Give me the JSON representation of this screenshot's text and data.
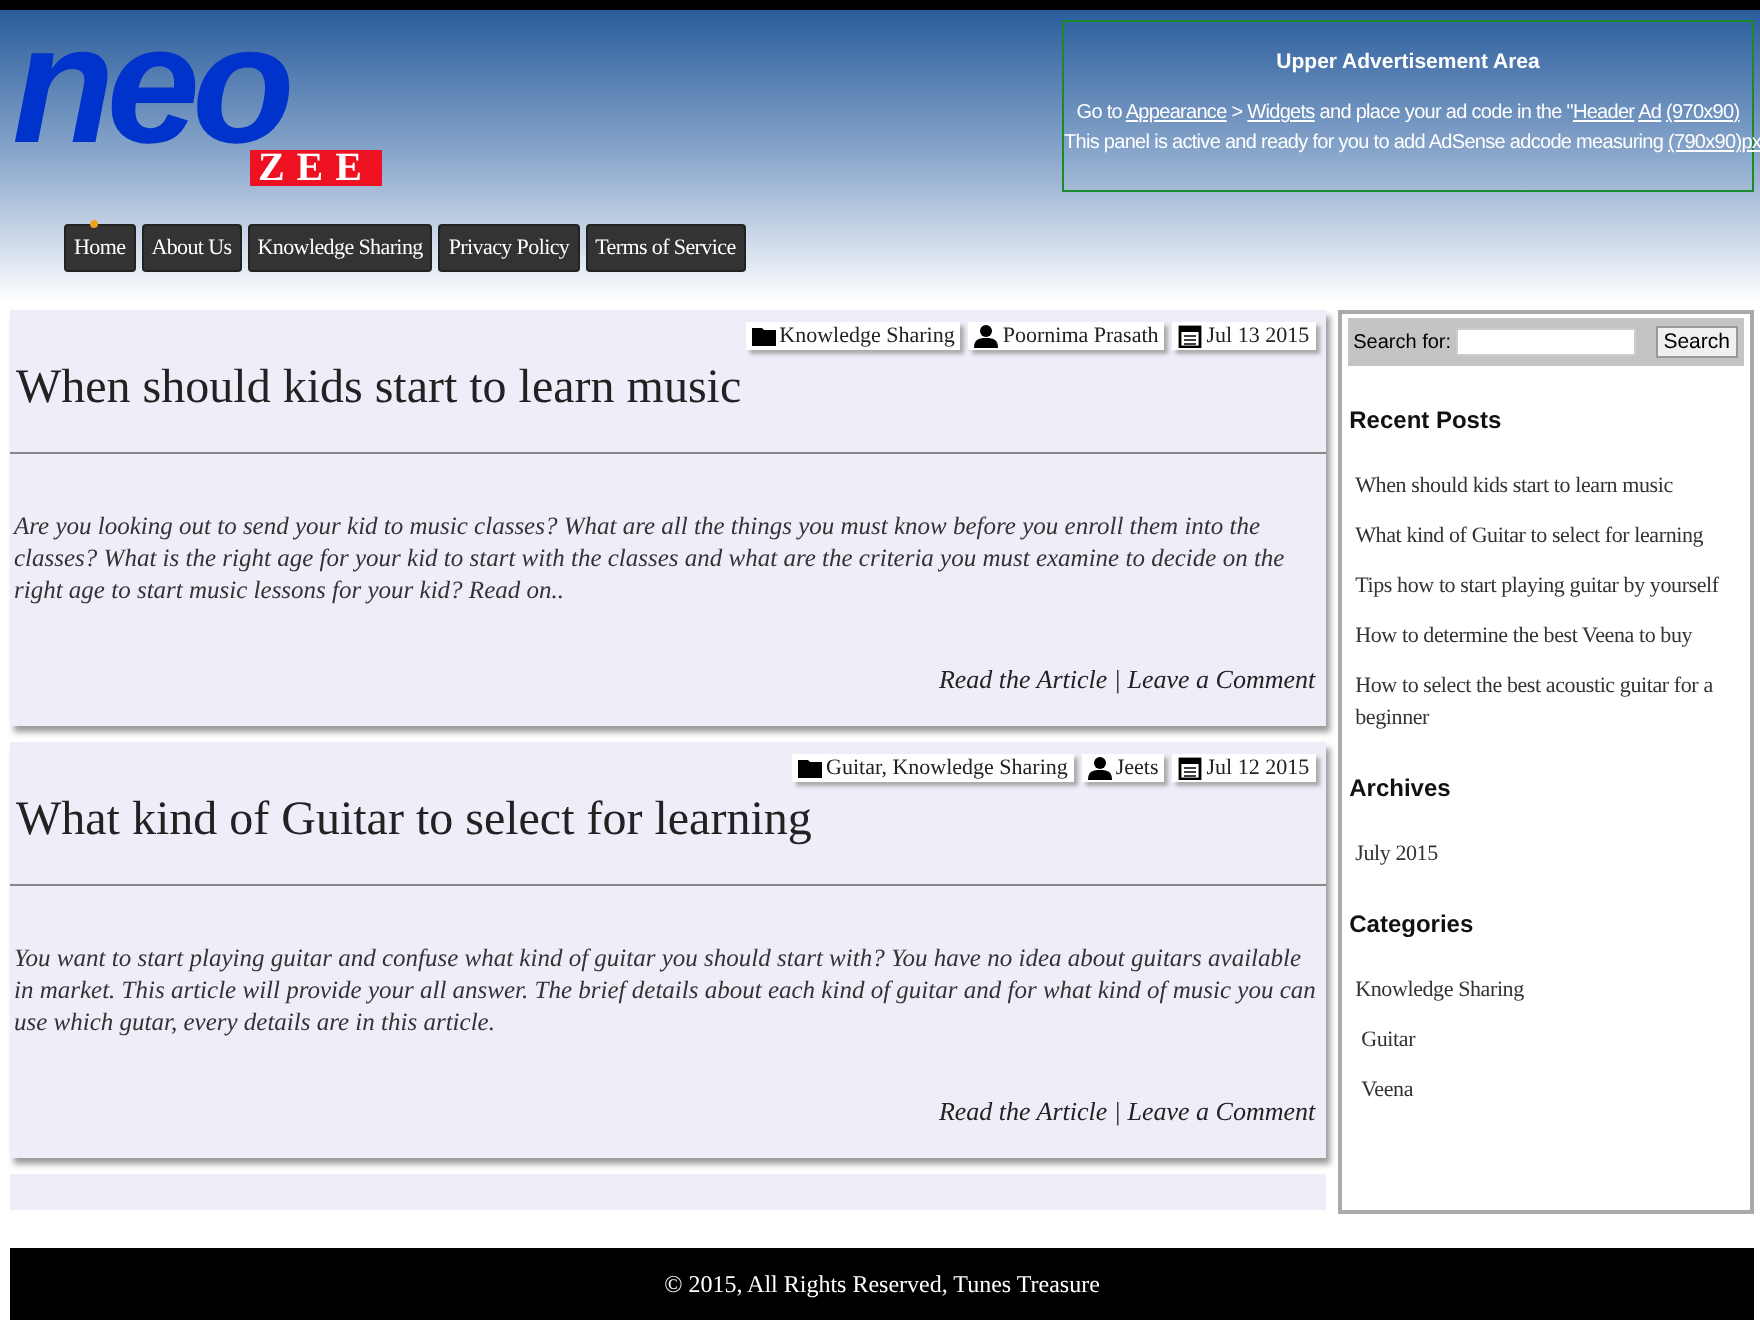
{
  "logo": {
    "main": "neo",
    "sub": "ZEE"
  },
  "nav": [
    {
      "label": "Home",
      "selected": true
    },
    {
      "label": "About Us",
      "selected": false
    },
    {
      "label": "Knowledge Sharing",
      "selected": false
    },
    {
      "label": "Privacy Policy",
      "selected": false
    },
    {
      "label": "Terms of Service",
      "selected": false
    }
  ],
  "ad": {
    "title": "Upper Advertisement Area",
    "lines": [
      [
        {
          "kind": "text",
          "text": "Go to "
        },
        {
          "kind": "link",
          "text": "Appearance"
        },
        {
          "kind": "text",
          "text": " > "
        },
        {
          "kind": "link",
          "text": "Widgets"
        },
        {
          "kind": "text",
          "text": " and place your ad code in the \""
        },
        {
          "kind": "link",
          "text": "Header"
        },
        {
          "kind": "link",
          "text": "Ad"
        },
        {
          "kind": "link",
          "text": "(970x90)"
        }
      ],
      [
        {
          "kind": "text",
          "text": "This panel is active and ready for you to add AdSense adcode measuring "
        },
        {
          "kind": "link",
          "text": "(790x90)px"
        }
      ]
    ]
  },
  "posts": [
    {
      "category": "Knowledge Sharing",
      "author": "Poornima Prasath",
      "date": "Jul 13 2015",
      "title": "When should kids start to learn music",
      "excerpt": "Are you looking out to send your kid to music classes? What are all the things you must know before you enroll them into the classes? What is the right age for your kid to start with the classes and what are the criteria you must examine to decide on the right age to start music lessons for your kid? Read on..",
      "read_link": "Read the Article",
      "separator": "|",
      "comment_link": "Leave a Comment"
    },
    {
      "category": "Guitar, Knowledge Sharing",
      "author": "Jeets",
      "date": "Jul 12 2015",
      "title": "What kind of Guitar to select for learning",
      "excerpt": "You want to start playing guitar and confuse what kind of guitar you should start with? You have no idea about guitars available in market. This article will provide your all answer. The brief details about each kind of guitar and for what kind of music you can use which gutar, every details are in this article.",
      "read_link": "Read the Article",
      "separator": "|",
      "comment_link": "Leave a Comment"
    }
  ],
  "sidebar": {
    "search": {
      "label": "Search for:",
      "button": "Search"
    },
    "recent_posts": {
      "title": "Recent Posts",
      "items": [
        "When should kids start to learn music",
        "What kind of Guitar to select for learning",
        "Tips how to start playing guitar by yourself",
        "How to determine the best Veena to buy",
        "How to select the best acoustic guitar for a beginner"
      ]
    },
    "archives": {
      "title": "Archives",
      "items": [
        "July 2015"
      ]
    },
    "categories": {
      "title": "Categories",
      "items": [
        {
          "label": "Knowledge Sharing",
          "children": [
            {
              "label": "Guitar"
            },
            {
              "label": "Veena"
            }
          ]
        }
      ]
    }
  },
  "footer": "© 2015, All Rights Reserved, Tunes Treasure"
}
